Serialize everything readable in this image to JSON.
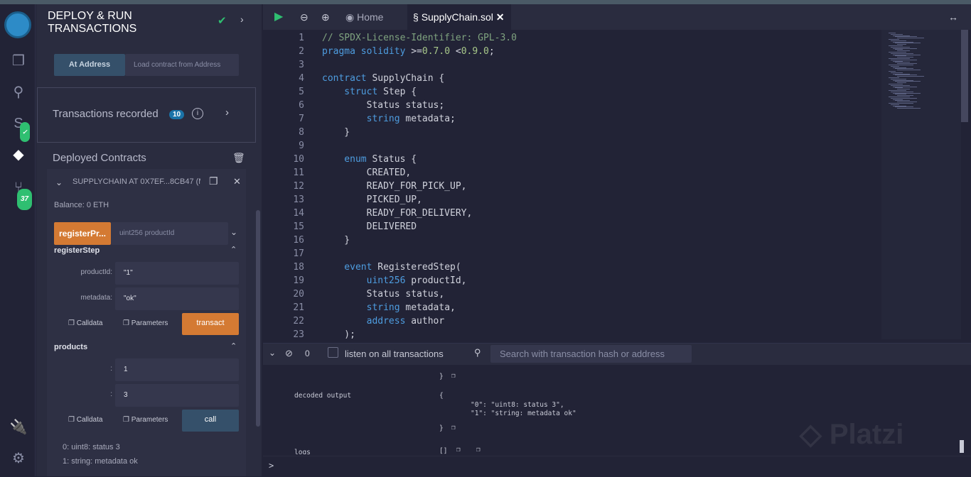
{
  "iconbar": {
    "items": [
      {
        "icon": "remix-logo-icon"
      },
      {
        "icon": "file-explorer-icon"
      },
      {
        "icon": "search-icon"
      },
      {
        "icon": "solidity-compiler-icon"
      },
      {
        "icon": "deploy-run-icon"
      },
      {
        "icon": "git-icon",
        "badge": "37"
      },
      {
        "icon": "plugin-icon"
      },
      {
        "icon": "settings-icon"
      }
    ]
  },
  "panel": {
    "title": "DEPLOY & RUN TRANSACTIONS",
    "at_address": "At Address",
    "load_contract_placeholder": "Load contract from Address",
    "transactions_recorded": "Transactions recorded",
    "transactions_count": "10",
    "deployed_contracts": "Deployed Contracts",
    "contract_name": "SUPPLYCHAIN AT 0X7EF...8CB47 (M",
    "balance": "Balance: 0 ETH",
    "register_product_btn": "registerPr...",
    "register_product_placeholder": "uint256 productId",
    "register_step": {
      "title": "registerStep",
      "fields": [
        {
          "label": "productId:",
          "value": "\"1\""
        },
        {
          "label": "metadata:",
          "value": "\"ok\""
        }
      ],
      "calldata": "Calldata",
      "parameters": "Parameters",
      "action": "transact"
    },
    "products": {
      "title": "products",
      "fields": [
        {
          "label": ":",
          "value": "1"
        },
        {
          "label": ":",
          "value": "3"
        }
      ],
      "calldata": "Calldata",
      "parameters": "Parameters",
      "action": "call"
    },
    "results": [
      "0: uint8: status 3",
      "1: string: metadata ok"
    ]
  },
  "editor": {
    "tabs": [
      {
        "label": "Home"
      },
      {
        "label": "SupplyChain.sol",
        "active": true
      }
    ],
    "lines": [
      [
        [
          "// SPDX-License-Identifier: GPL-3.0",
          "comment"
        ]
      ],
      [
        [
          "pragma solidity ",
          "kw"
        ],
        [
          ">=",
          "plain"
        ],
        [
          "0.7.0",
          "num"
        ],
        [
          " <",
          "plain"
        ],
        [
          "0.9.0",
          "num"
        ],
        [
          ";",
          "plain"
        ]
      ],
      [],
      [
        [
          "contract ",
          "kw"
        ],
        [
          "SupplyChain {",
          "plain"
        ]
      ],
      [
        [
          "    struct ",
          "kw"
        ],
        [
          "Step {",
          "plain"
        ]
      ],
      [
        [
          "        Status status;",
          "plain"
        ]
      ],
      [
        [
          "        string ",
          "kw"
        ],
        [
          "metadata;",
          "plain"
        ]
      ],
      [
        [
          "    }",
          "plain"
        ]
      ],
      [],
      [
        [
          "    enum ",
          "kw"
        ],
        [
          "Status {",
          "plain"
        ]
      ],
      [
        [
          "        CREATED,",
          "plain"
        ]
      ],
      [
        [
          "        READY_FOR_PICK_UP,",
          "plain"
        ]
      ],
      [
        [
          "        PICKED_UP,",
          "plain"
        ]
      ],
      [
        [
          "        READY_FOR_DELIVERY,",
          "plain"
        ]
      ],
      [
        [
          "        DELIVERED",
          "plain"
        ]
      ],
      [
        [
          "    }",
          "plain"
        ]
      ],
      [],
      [
        [
          "    event ",
          "kw"
        ],
        [
          "RegisteredStep(",
          "plain"
        ]
      ],
      [
        [
          "        uint256 ",
          "kw"
        ],
        [
          "productId,",
          "plain"
        ]
      ],
      [
        [
          "        Status status,",
          "plain"
        ]
      ],
      [
        [
          "        string ",
          "kw"
        ],
        [
          "metadata,",
          "plain"
        ]
      ],
      [
        [
          "        address ",
          "kw"
        ],
        [
          "author",
          "plain"
        ]
      ],
      [
        [
          "    );",
          "plain"
        ]
      ]
    ]
  },
  "terminal": {
    "pending_count": "0",
    "listen_label": "listen on all transactions",
    "search_placeholder": "Search with transaction hash or address",
    "close_brace": "}",
    "decoded_output_label": "decoded output",
    "open_brace": "{",
    "output_line_0": "\"0\": \"uint8: status 3\",",
    "output_line_1": "\"1\": \"string: metadata ok\"",
    "logs_label": "logs",
    "logs_value": "[]",
    "prompt": ">"
  },
  "watermark": "Platzi",
  "colors": {
    "accent_orange": "#d47a33",
    "accent_blue": "#35506a",
    "badge_blue": "#1a73a8",
    "badge_green": "#2fbf71"
  }
}
